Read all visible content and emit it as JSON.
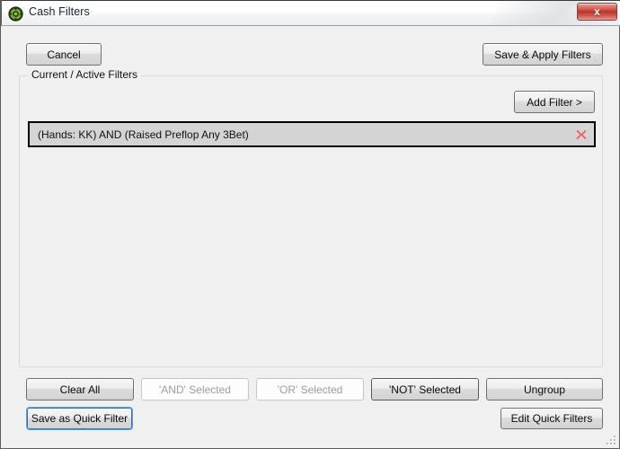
{
  "window": {
    "title": "Cash Filters",
    "icon": "poker-chip-icon",
    "close_label": "x",
    "frame_color": "#5c5c5c",
    "client_background": "#f0f0f0"
  },
  "toolbar": {
    "cancel_label": "Cancel",
    "save_apply_label": "Save & Apply Filters"
  },
  "group": {
    "legend": "Current / Active Filters",
    "add_filter_label": "Add Filter >"
  },
  "filters": [
    {
      "text": "(Hands: KK) AND (Raised Preflop Any 3Bet)",
      "selected": true,
      "delete_icon": "red-x-icon",
      "delete_color": "#f2605f"
    }
  ],
  "actions": {
    "clear_all_label": "Clear All",
    "and_selected_label": "'AND' Selected",
    "or_selected_label": "'OR' Selected",
    "not_selected_label": "'NOT' Selected",
    "ungroup_label": "Ungroup",
    "and_selected_enabled": false,
    "or_selected_enabled": false,
    "not_selected_enabled": true,
    "ungroup_enabled": true
  },
  "footer": {
    "save_quick_filter_label": "Save as Quick Filter",
    "edit_quick_filters_label": "Edit Quick Filters",
    "focus_color": "#3a6fa8"
  }
}
